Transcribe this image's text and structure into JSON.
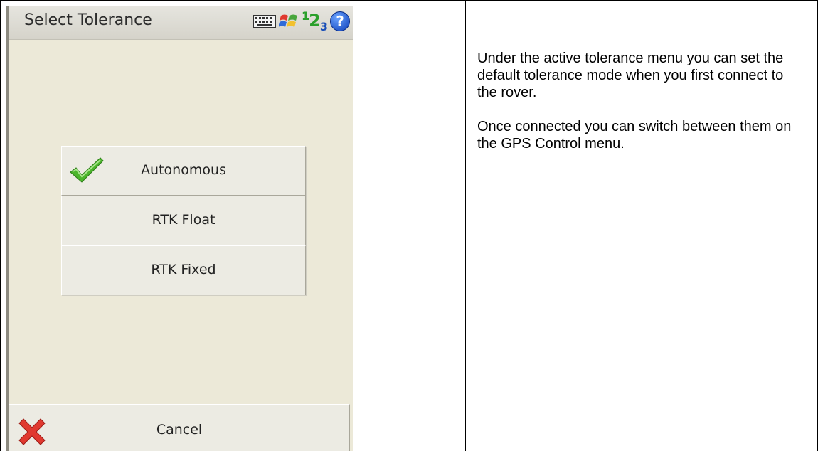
{
  "device": {
    "title": "Select Tolerance",
    "tray_icons": [
      "keyboard-icon",
      "windows-flag-icon",
      "input-mode-icon",
      "help-icon"
    ],
    "input_mode": {
      "digits": [
        "1",
        "2",
        "3"
      ]
    },
    "help_glyph": "?"
  },
  "options": [
    {
      "label": "Autonomous",
      "selected": true
    },
    {
      "label": "RTK Float",
      "selected": false
    },
    {
      "label": "RTK Fixed",
      "selected": false
    }
  ],
  "cancel": {
    "label": "Cancel"
  },
  "description": {
    "paragraphs": [
      "Under the active tolerance menu you can set the default tolerance mode when you first connect to the rover.",
      "Once connected you can switch between them on the GPS Control menu."
    ]
  },
  "colors": {
    "screen_bg": "#ece9d8",
    "check": "#4cb52c",
    "cancel_x": "#e0392f",
    "input_mode_green": "#2ba02b",
    "input_mode_blue": "#1a4fb8"
  }
}
